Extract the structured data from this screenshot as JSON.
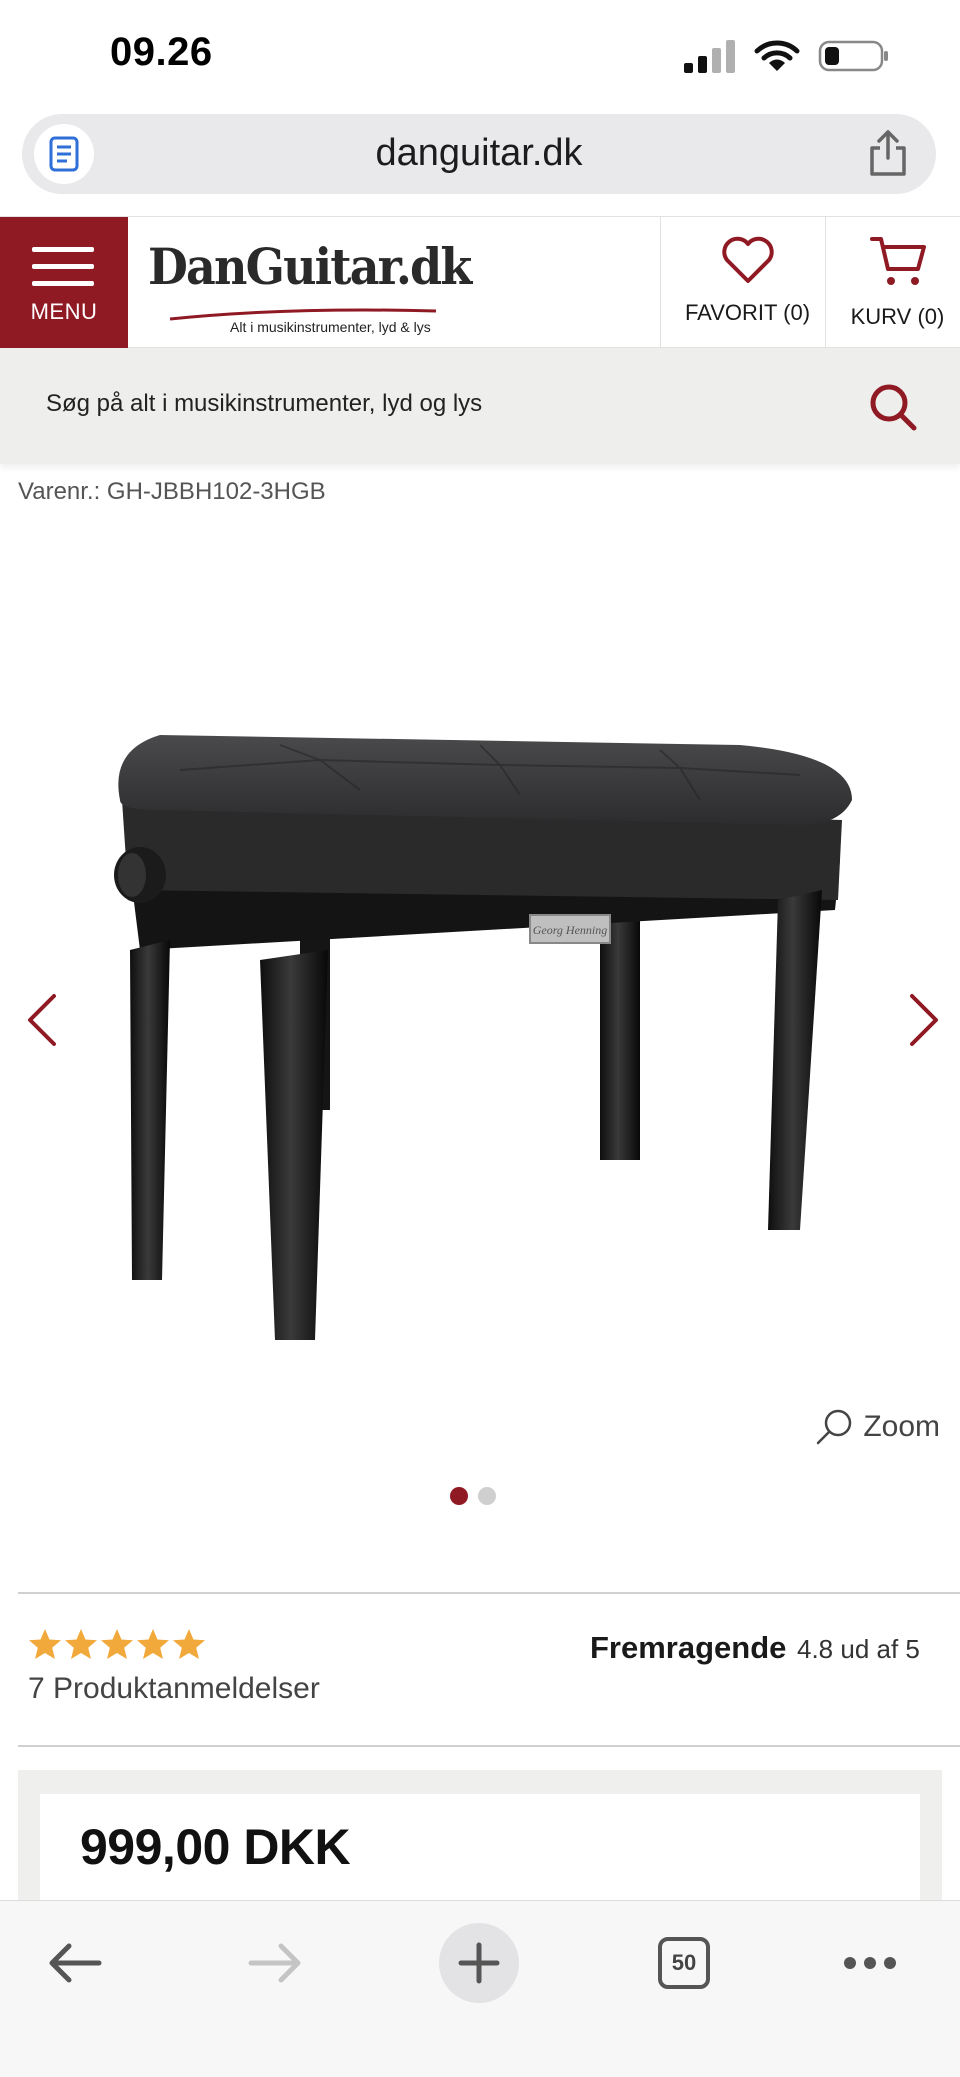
{
  "status_bar": {
    "time": "09.26"
  },
  "browser": {
    "url": "danguitar.dk",
    "tab_count": "50"
  },
  "header": {
    "menu_label": "MENU",
    "logo_text": "DanGuitar.dk",
    "logo_tagline": "Alt i musikinstrumenter, lyd & lys",
    "favorites_label": "FAVORIT (0)",
    "cart_label": "KURV (0)",
    "brand_color": "#8f1a24"
  },
  "search": {
    "placeholder": "Søg på alt i musikinstrumenter, lyd og lys"
  },
  "product": {
    "sku": "Varenr.: GH-JBBH102-3HGB",
    "zoom_label": "Zoom",
    "image_count": 2,
    "active_image": 1,
    "badge_text": "Georg Henning",
    "rating_stars": 5,
    "reviews_label": "7 Produktanmeldelser",
    "rating_word": "Fremragende",
    "rating_value": "4.8 ud af 5",
    "price": "999,00 DKK"
  },
  "icons": {
    "reader": "reader-icon",
    "share": "share-icon",
    "heart": "heart-icon",
    "cart": "cart-icon",
    "search": "search-icon",
    "prev": "chevron-left-icon",
    "next": "chevron-right-icon",
    "back": "back-arrow-icon",
    "forward": "forward-arrow-icon",
    "new_tab": "plus-icon",
    "tabs": "tabs-icon",
    "more": "more-icon"
  }
}
